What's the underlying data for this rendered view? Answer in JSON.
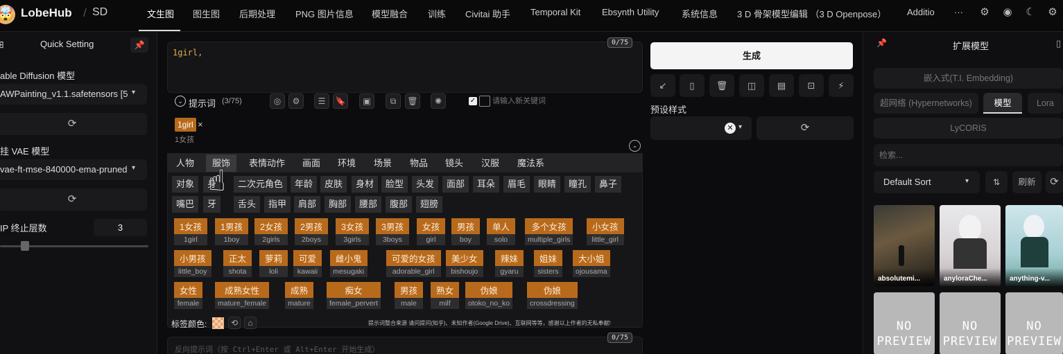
{
  "brand": {
    "emoji": "🤯",
    "name": "LobeHub",
    "sep": "/",
    "sub": "SD"
  },
  "nav": [
    "文生图",
    "图生图",
    "后期处理",
    "PNG 图片信息",
    "模型融合",
    "训练",
    "Civitai 助手",
    "Temporal Kit",
    "Ebsynth Utility",
    "系统信息",
    "3 D 骨架模型编辑 （3 D Openpose）",
    "Additio"
  ],
  "nav_more": "···",
  "left": {
    "quick_setting": "Quick Setting",
    "sd_model_label": "able Diffusion 模型",
    "sd_model_value": "AWPainting_v1.1.safetensors [5",
    "vae_label": "挂 VAE 模型",
    "vae_value": "vae-ft-mse-840000-ema-pruned",
    "clip_label": "IP 终止层数",
    "clip_value": "3",
    "slider_fraction": 0.14
  },
  "prompt": {
    "text": "1girl,",
    "counter": "0/75",
    "label": "提示词",
    "count": "(3/75)",
    "keyword_placeholder": "请输入新关键词",
    "chip": "1girl",
    "chip_close": "×",
    "chip_sub": "1女孩",
    "neg_placeholder": "反向提示词（按 Ctrl+Enter 或 Alt+Enter 开始生成）",
    "neg_counter": "0/75"
  },
  "categories": [
    "人物",
    "服饰",
    "表情动作",
    "画面",
    "环境",
    "场景",
    "物品",
    "镜头",
    "汉服",
    "魔法系"
  ],
  "subtabs_row1": [
    "对象",
    "身",
    "二次元角色",
    "年龄",
    "皮肤",
    "身材",
    "脸型",
    "头发",
    "面部",
    "耳朵",
    "眉毛",
    "眼睛",
    "瞳孔",
    "鼻子"
  ],
  "subtabs_row2": [
    "嘴巴",
    "牙",
    "舌头",
    "指甲",
    "肩部",
    "胸部",
    "腰部",
    "腹部",
    "翅膀"
  ],
  "tags_row1": [
    [
      "1女孩",
      "1girl"
    ],
    [
      "1男孩",
      "1boy"
    ],
    [
      "2女孩",
      "2girls"
    ],
    [
      "2男孩",
      "2boys"
    ],
    [
      "3女孩",
      "3girls"
    ],
    [
      "3男孩",
      "3boys"
    ],
    [
      "女孩",
      "girl"
    ],
    [
      "男孩",
      "boy"
    ],
    [
      "单人",
      "solo"
    ],
    [
      "多个女孩",
      "multiple_girls"
    ],
    [
      "小女孩",
      "little_girl"
    ]
  ],
  "tags_row2": [
    [
      "小男孩",
      "little_boy"
    ],
    [
      "正太",
      "shota"
    ],
    [
      "萝莉",
      "loli"
    ],
    [
      "可爱",
      "kawaii"
    ],
    [
      "雌小鬼",
      "mesugaki"
    ],
    [
      "可爱的女孩",
      "adorable_girl"
    ],
    [
      "美少女",
      "bishoujo"
    ],
    [
      "辣妹",
      "gyaru"
    ],
    [
      "姐妹",
      "sisters"
    ],
    [
      "大小姐",
      "ojousama"
    ]
  ],
  "tags_row3": [
    [
      "女性",
      "female"
    ],
    [
      "成熟女性",
      "mature_female"
    ],
    [
      "成熟",
      "mature"
    ],
    [
      "痴女",
      "female_pervert"
    ],
    [
      "男孩",
      "male"
    ],
    [
      "熟女",
      "milf"
    ],
    [
      "伪娘",
      "otoko_no_ko"
    ],
    [
      "伪娘",
      "crossdressing"
    ]
  ],
  "tag_color_label": "标签颜色:",
  "credits": "提示词整合来源 请问提问(知乎)、未知作者(Google Drive)、互联网等等，感谢以上作者的无私奉献!",
  "generate": {
    "label": "生成",
    "preset_label": "预设样式"
  },
  "ext": {
    "title": "扩展模型",
    "embedding": "嵌入式(T.I. Embedding)",
    "hypernet": "超网络 (Hypernetworks)",
    "model": "模型",
    "lora": "Lora",
    "lycoris": "LyCORIS",
    "search_placeholder": "检索...",
    "sort": "Default Sort",
    "refresh": "刷新",
    "cards": [
      "absolutemi...",
      "anyloraChe...",
      "anything-v..."
    ],
    "noprev": "NO PREVIEW"
  },
  "colors": {
    "accent": "#b86a1c",
    "bg": "#0c0c0e"
  }
}
